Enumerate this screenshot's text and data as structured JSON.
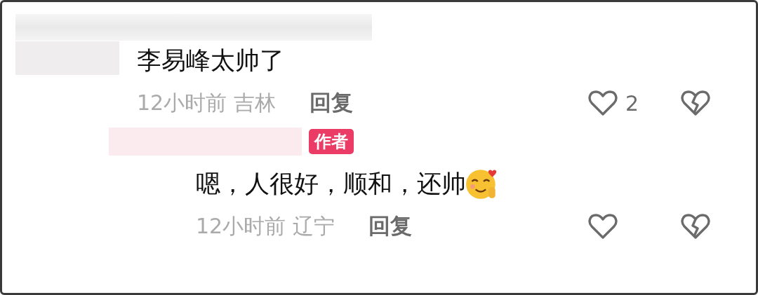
{
  "comments": [
    {
      "kind": "comment",
      "content": "李易峰太帅了",
      "time": "12小时前",
      "location": "吉林",
      "reply": "回复",
      "likes": "2"
    },
    {
      "kind": "reply",
      "author_badge": "作者",
      "content": "嗯，人很好，顺和，还帅",
      "time": "12小时前",
      "location": "辽宁",
      "reply": "回复"
    }
  ]
}
